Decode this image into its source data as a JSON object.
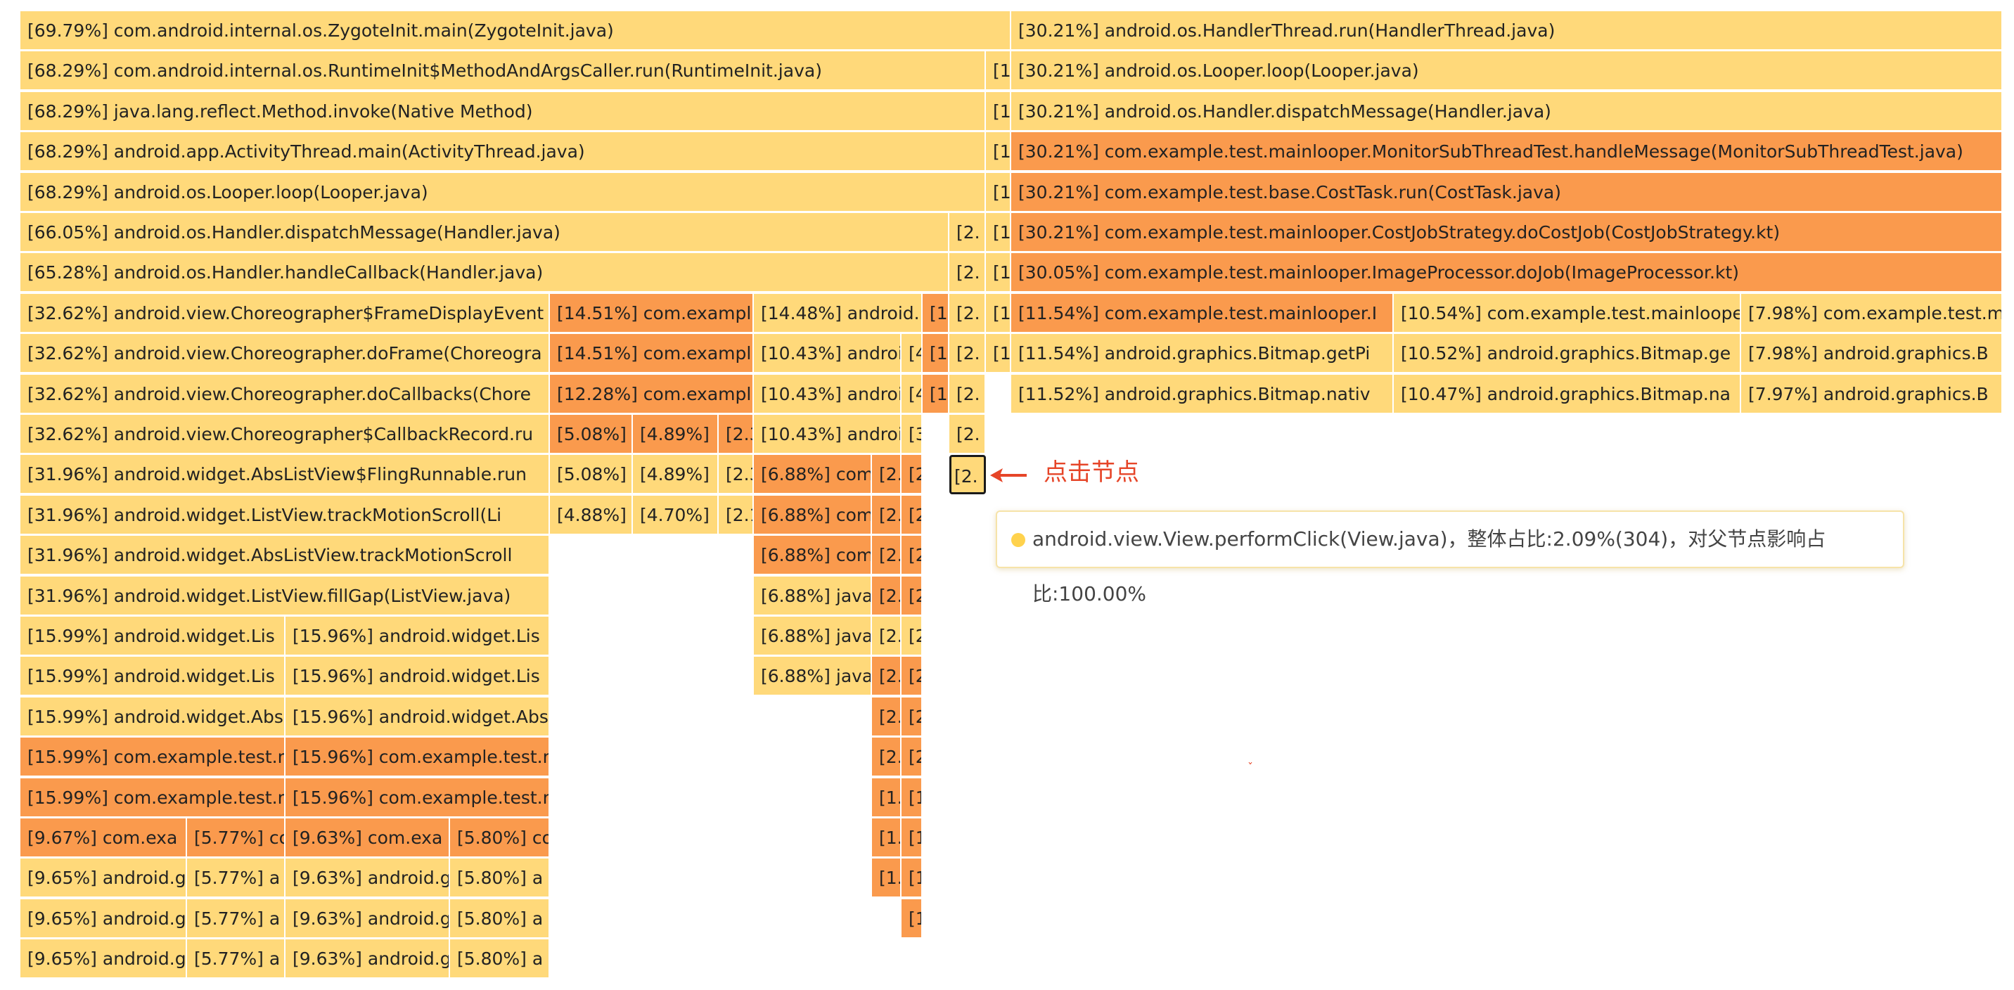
{
  "colors": {
    "warm": "#ffd97a",
    "hot": "#fa9a4d",
    "selected_border": "#1a1a1a",
    "annotation": "#e64528"
  },
  "selected_frame": {
    "label": "[2."
  },
  "annotation": {
    "text": "点击节点",
    "arrow_icon": "left-arrow-icon"
  },
  "tooltip": {
    "text": "android.view.View.performClick(View.java)，整体占比:2.09%(304)，对父节点影响占比:100.00%",
    "dot_icon": "status-dot-icon"
  },
  "stray_mark": "ˇ",
  "frames": [
    {
      "row": 0,
      "s": 29,
      "e": 1438,
      "label": "[69.79%] com.android.internal.os.ZygoteInit.main(ZygoteInit.java)",
      "c": "y"
    },
    {
      "row": 0,
      "s": 1438,
      "e": 2848,
      "label": "[30.21%] android.os.HandlerThread.run(HandlerThread.java)",
      "c": "y"
    },
    {
      "row": 1,
      "s": 29,
      "e": 1402,
      "label": "[68.29%] com.android.internal.os.RuntimeInit$MethodAndArgsCaller.run(RuntimeInit.java)",
      "c": "y"
    },
    {
      "row": 1,
      "s": 1402,
      "e": 1438,
      "label": "[1",
      "c": "y"
    },
    {
      "row": 1,
      "s": 1438,
      "e": 2848,
      "label": "[30.21%] android.os.Looper.loop(Looper.java)",
      "c": "y"
    },
    {
      "row": 2,
      "s": 29,
      "e": 1402,
      "label": "[68.29%] java.lang.reflect.Method.invoke(Native Method)",
      "c": "y"
    },
    {
      "row": 2,
      "s": 1402,
      "e": 1438,
      "label": "[1",
      "c": "y"
    },
    {
      "row": 2,
      "s": 1438,
      "e": 2848,
      "label": "[30.21%] android.os.Handler.dispatchMessage(Handler.java)",
      "c": "y"
    },
    {
      "row": 3,
      "s": 29,
      "e": 1402,
      "label": "[68.29%] android.app.ActivityThread.main(ActivityThread.java)",
      "c": "y"
    },
    {
      "row": 3,
      "s": 1402,
      "e": 1438,
      "label": "[1",
      "c": "y"
    },
    {
      "row": 3,
      "s": 1438,
      "e": 2848,
      "label": "[30.21%] com.example.test.mainlooper.MonitorSubThreadTest.handleMessage(MonitorSubThreadTest.java)",
      "c": "o"
    },
    {
      "row": 4,
      "s": 29,
      "e": 1402,
      "label": "[68.29%] android.os.Looper.loop(Looper.java)",
      "c": "y"
    },
    {
      "row": 4,
      "s": 1402,
      "e": 1438,
      "label": "[1",
      "c": "y"
    },
    {
      "row": 4,
      "s": 1438,
      "e": 2848,
      "label": "[30.21%] com.example.test.base.CostTask.run(CostTask.java)",
      "c": "o"
    },
    {
      "row": 5,
      "s": 29,
      "e": 1350,
      "label": "[66.05%] android.os.Handler.dispatchMessage(Handler.java)",
      "c": "y"
    },
    {
      "row": 5,
      "s": 1350,
      "e": 1402,
      "label": "[2.",
      "c": "y"
    },
    {
      "row": 5,
      "s": 1402,
      "e": 1438,
      "label": "[1",
      "c": "y"
    },
    {
      "row": 5,
      "s": 1438,
      "e": 2848,
      "label": "[30.21%] com.example.test.mainlooper.CostJobStrategy.doCostJob(CostJobStrategy.kt)",
      "c": "o"
    },
    {
      "row": 6,
      "s": 29,
      "e": 1350,
      "label": "[65.28%] android.os.Handler.handleCallback(Handler.java)",
      "c": "y"
    },
    {
      "row": 6,
      "s": 1350,
      "e": 1402,
      "label": "[2.",
      "c": "y"
    },
    {
      "row": 6,
      "s": 1402,
      "e": 1438,
      "label": "[1",
      "c": "y"
    },
    {
      "row": 6,
      "s": 1438,
      "e": 2848,
      "label": "[30.05%] com.example.test.mainlooper.ImageProcessor.doJob(ImageProcessor.kt)",
      "c": "o"
    },
    {
      "row": 7,
      "s": 29,
      "e": 782,
      "label": "[32.62%] android.view.Choreographer$FrameDisplayEvent",
      "c": "y"
    },
    {
      "row": 7,
      "s": 782,
      "e": 1072,
      "label": "[14.51%] com.exampl",
      "c": "o"
    },
    {
      "row": 7,
      "s": 1072,
      "e": 1312,
      "label": "[14.48%] android.",
      "c": "y"
    },
    {
      "row": 7,
      "s": 1312,
      "e": 1350,
      "label": "[1.",
      "c": "o"
    },
    {
      "row": 7,
      "s": 1350,
      "e": 1402,
      "label": "[2.",
      "c": "y"
    },
    {
      "row": 7,
      "s": 1402,
      "e": 1438,
      "label": "[1",
      "c": "y"
    },
    {
      "row": 7,
      "s": 1438,
      "e": 1982,
      "label": "[11.54%] com.example.test.mainlooper.I",
      "c": "o"
    },
    {
      "row": 7,
      "s": 1982,
      "e": 2476,
      "label": "[10.54%] com.example.test.mainloope",
      "c": "y"
    },
    {
      "row": 7,
      "s": 2476,
      "e": 2848,
      "label": "[7.98%] com.example.test.m",
      "c": "y"
    },
    {
      "row": 8,
      "s": 29,
      "e": 782,
      "label": "[32.62%] android.view.Choreographer.doFrame(Choreogra",
      "c": "y"
    },
    {
      "row": 8,
      "s": 782,
      "e": 1072,
      "label": "[14.51%] com.exampl",
      "c": "o"
    },
    {
      "row": 8,
      "s": 1072,
      "e": 1282,
      "label": "[10.43%] androi",
      "c": "y"
    },
    {
      "row": 8,
      "s": 1282,
      "e": 1312,
      "label": "[4",
      "c": "y"
    },
    {
      "row": 8,
      "s": 1312,
      "e": 1350,
      "label": "[1.",
      "c": "o"
    },
    {
      "row": 8,
      "s": 1350,
      "e": 1402,
      "label": "[2.",
      "c": "y"
    },
    {
      "row": 8,
      "s": 1402,
      "e": 1438,
      "label": "[1",
      "c": "y"
    },
    {
      "row": 8,
      "s": 1438,
      "e": 1982,
      "label": "[11.54%] android.graphics.Bitmap.getPi",
      "c": "y"
    },
    {
      "row": 8,
      "s": 1982,
      "e": 2476,
      "label": "[10.52%] android.graphics.Bitmap.ge",
      "c": "y"
    },
    {
      "row": 8,
      "s": 2476,
      "e": 2848,
      "label": "[7.98%] android.graphics.B",
      "c": "y"
    },
    {
      "row": 9,
      "s": 29,
      "e": 782,
      "label": "[32.62%] android.view.Choreographer.doCallbacks(Chore",
      "c": "y"
    },
    {
      "row": 9,
      "s": 782,
      "e": 1072,
      "label": "[12.28%] com.exampl",
      "c": "o"
    },
    {
      "row": 9,
      "s": 1072,
      "e": 1282,
      "label": "[10.43%] androi",
      "c": "y"
    },
    {
      "row": 9,
      "s": 1282,
      "e": 1312,
      "label": "[4",
      "c": "y"
    },
    {
      "row": 9,
      "s": 1312,
      "e": 1350,
      "label": "[1.",
      "c": "o"
    },
    {
      "row": 9,
      "s": 1350,
      "e": 1402,
      "label": "[2.",
      "c": "y"
    },
    {
      "row": 9,
      "s": 1438,
      "e": 1982,
      "label": "[11.52%] android.graphics.Bitmap.nativ",
      "c": "y"
    },
    {
      "row": 9,
      "s": 1982,
      "e": 2476,
      "label": "[10.47%] android.graphics.Bitmap.na",
      "c": "y"
    },
    {
      "row": 9,
      "s": 2476,
      "e": 2848,
      "label": "[7.97%] android.graphics.B",
      "c": "y"
    },
    {
      "row": 10,
      "s": 29,
      "e": 782,
      "label": "[32.62%] android.view.Choreographer$CallbackRecord.ru",
      "c": "y"
    },
    {
      "row": 10,
      "s": 782,
      "e": 900,
      "label": "[5.08%]",
      "c": "o"
    },
    {
      "row": 10,
      "s": 900,
      "e": 1022,
      "label": "[4.89%]",
      "c": "o"
    },
    {
      "row": 10,
      "s": 1022,
      "e": 1072,
      "label": "[2.3",
      "c": "o"
    },
    {
      "row": 10,
      "s": 1072,
      "e": 1282,
      "label": "[10.43%] androi",
      "c": "y"
    },
    {
      "row": 10,
      "s": 1282,
      "e": 1312,
      "label": "[3",
      "c": "y"
    },
    {
      "row": 10,
      "s": 1350,
      "e": 1402,
      "label": "[2.",
      "c": "y"
    },
    {
      "row": 11,
      "s": 29,
      "e": 782,
      "label": "[31.96%] android.widget.AbsListView$FlingRunnable.run",
      "c": "y"
    },
    {
      "row": 11,
      "s": 782,
      "e": 900,
      "label": "[5.08%]",
      "c": "y"
    },
    {
      "row": 11,
      "s": 900,
      "e": 1022,
      "label": "[4.89%]",
      "c": "y"
    },
    {
      "row": 11,
      "s": 1022,
      "e": 1072,
      "label": "[2.3",
      "c": "y"
    },
    {
      "row": 11,
      "s": 1072,
      "e": 1240,
      "label": "[6.88%] com",
      "c": "o"
    },
    {
      "row": 11,
      "s": 1240,
      "e": 1282,
      "label": "[2.",
      "c": "o"
    },
    {
      "row": 11,
      "s": 1282,
      "e": 1312,
      "label": "[2",
      "c": "o"
    },
    {
      "row": 12,
      "s": 29,
      "e": 782,
      "label": "[31.96%] android.widget.ListView.trackMotionScroll(Li",
      "c": "y"
    },
    {
      "row": 12,
      "s": 782,
      "e": 900,
      "label": "[4.88%]",
      "c": "y"
    },
    {
      "row": 12,
      "s": 900,
      "e": 1022,
      "label": "[4.70%]",
      "c": "y"
    },
    {
      "row": 12,
      "s": 1022,
      "e": 1072,
      "label": "[2.1",
      "c": "y"
    },
    {
      "row": 12,
      "s": 1072,
      "e": 1240,
      "label": "[6.88%] com",
      "c": "o"
    },
    {
      "row": 12,
      "s": 1240,
      "e": 1282,
      "label": "[2.",
      "c": "o"
    },
    {
      "row": 12,
      "s": 1282,
      "e": 1312,
      "label": "[2",
      "c": "o"
    },
    {
      "row": 13,
      "s": 29,
      "e": 782,
      "label": "[31.96%] android.widget.AbsListView.trackMotionScroll",
      "c": "y"
    },
    {
      "row": 13,
      "s": 1072,
      "e": 1240,
      "label": "[6.88%] com",
      "c": "o"
    },
    {
      "row": 13,
      "s": 1240,
      "e": 1282,
      "label": "[2.",
      "c": "o"
    },
    {
      "row": 13,
      "s": 1282,
      "e": 1312,
      "label": "[2",
      "c": "o"
    },
    {
      "row": 14,
      "s": 29,
      "e": 782,
      "label": "[31.96%] android.widget.ListView.fillGap(ListView.java)",
      "c": "y"
    },
    {
      "row": 14,
      "s": 1072,
      "e": 1240,
      "label": "[6.88%] java",
      "c": "y"
    },
    {
      "row": 14,
      "s": 1240,
      "e": 1282,
      "label": "[2.",
      "c": "o"
    },
    {
      "row": 14,
      "s": 1282,
      "e": 1312,
      "label": "[2",
      "c": "o"
    },
    {
      "row": 15,
      "s": 29,
      "e": 406,
      "label": "[15.99%] android.widget.Lis",
      "c": "y"
    },
    {
      "row": 15,
      "s": 406,
      "e": 782,
      "label": "[15.96%] android.widget.Lis",
      "c": "y"
    },
    {
      "row": 15,
      "s": 1072,
      "e": 1240,
      "label": "[6.88%] java",
      "c": "y"
    },
    {
      "row": 15,
      "s": 1240,
      "e": 1282,
      "label": "[2.",
      "c": "y"
    },
    {
      "row": 15,
      "s": 1282,
      "e": 1312,
      "label": "[2",
      "c": "y"
    },
    {
      "row": 16,
      "s": 29,
      "e": 406,
      "label": "[15.99%] android.widget.Lis",
      "c": "y"
    },
    {
      "row": 16,
      "s": 406,
      "e": 782,
      "label": "[15.96%] android.widget.Lis",
      "c": "y"
    },
    {
      "row": 16,
      "s": 1072,
      "e": 1240,
      "label": "[6.88%] java",
      "c": "y"
    },
    {
      "row": 16,
      "s": 1240,
      "e": 1282,
      "label": "[2.",
      "c": "o"
    },
    {
      "row": 16,
      "s": 1282,
      "e": 1312,
      "label": "[2",
      "c": "o"
    },
    {
      "row": 17,
      "s": 29,
      "e": 406,
      "label": "[15.99%] android.widget.Abs",
      "c": "y"
    },
    {
      "row": 17,
      "s": 406,
      "e": 782,
      "label": "[15.96%] android.widget.Abs",
      "c": "y"
    },
    {
      "row": 17,
      "s": 1240,
      "e": 1282,
      "label": "[2.",
      "c": "o"
    },
    {
      "row": 17,
      "s": 1282,
      "e": 1312,
      "label": "[2",
      "c": "o"
    },
    {
      "row": 18,
      "s": 29,
      "e": 406,
      "label": "[15.99%] com.example.test.m",
      "c": "o"
    },
    {
      "row": 18,
      "s": 406,
      "e": 782,
      "label": "[15.96%] com.example.test.m",
      "c": "o"
    },
    {
      "row": 18,
      "s": 1240,
      "e": 1282,
      "label": "[2.",
      "c": "o"
    },
    {
      "row": 18,
      "s": 1282,
      "e": 1312,
      "label": "[2",
      "c": "o"
    },
    {
      "row": 19,
      "s": 29,
      "e": 406,
      "label": "[15.99%] com.example.test.m",
      "c": "o"
    },
    {
      "row": 19,
      "s": 406,
      "e": 782,
      "label": "[15.96%] com.example.test.m",
      "c": "o"
    },
    {
      "row": 19,
      "s": 1240,
      "e": 1282,
      "label": "[1.",
      "c": "o"
    },
    {
      "row": 19,
      "s": 1282,
      "e": 1312,
      "label": "[1",
      "c": "o"
    },
    {
      "row": 20,
      "s": 29,
      "e": 266,
      "label": "[9.67%] com.exa",
      "c": "o"
    },
    {
      "row": 20,
      "s": 266,
      "e": 406,
      "label": "[5.77%] co",
      "c": "o"
    },
    {
      "row": 20,
      "s": 406,
      "e": 640,
      "label": "[9.63%] com.exa",
      "c": "o"
    },
    {
      "row": 20,
      "s": 640,
      "e": 782,
      "label": "[5.80%] co",
      "c": "o"
    },
    {
      "row": 20,
      "s": 1240,
      "e": 1282,
      "label": "[1.",
      "c": "o"
    },
    {
      "row": 20,
      "s": 1282,
      "e": 1312,
      "label": "[1",
      "c": "o"
    },
    {
      "row": 21,
      "s": 29,
      "e": 266,
      "label": "[9.65%] android.g",
      "c": "y"
    },
    {
      "row": 21,
      "s": 266,
      "e": 406,
      "label": "[5.77%] a",
      "c": "y"
    },
    {
      "row": 21,
      "s": 406,
      "e": 640,
      "label": "[9.63%] android.g",
      "c": "y"
    },
    {
      "row": 21,
      "s": 640,
      "e": 782,
      "label": "[5.80%] a",
      "c": "y"
    },
    {
      "row": 21,
      "s": 1240,
      "e": 1282,
      "label": "[1.",
      "c": "o"
    },
    {
      "row": 21,
      "s": 1282,
      "e": 1312,
      "label": "[1",
      "c": "o"
    },
    {
      "row": 22,
      "s": 29,
      "e": 266,
      "label": "[9.65%] android.g",
      "c": "y"
    },
    {
      "row": 22,
      "s": 266,
      "e": 406,
      "label": "[5.77%] a",
      "c": "y"
    },
    {
      "row": 22,
      "s": 406,
      "e": 640,
      "label": "[9.63%] android.g",
      "c": "y"
    },
    {
      "row": 22,
      "s": 640,
      "e": 782,
      "label": "[5.80%] a",
      "c": "y"
    },
    {
      "row": 22,
      "s": 1282,
      "e": 1312,
      "label": "[1",
      "c": "o"
    },
    {
      "row": 23,
      "s": 29,
      "e": 266,
      "label": "[9.65%] android.g",
      "c": "y"
    },
    {
      "row": 23,
      "s": 266,
      "e": 406,
      "label": "[5.77%] a",
      "c": "y"
    },
    {
      "row": 23,
      "s": 406,
      "e": 640,
      "label": "[9.63%] android.g",
      "c": "y"
    },
    {
      "row": 23,
      "s": 640,
      "e": 782,
      "label": "[5.80%] a",
      "c": "y"
    }
  ]
}
